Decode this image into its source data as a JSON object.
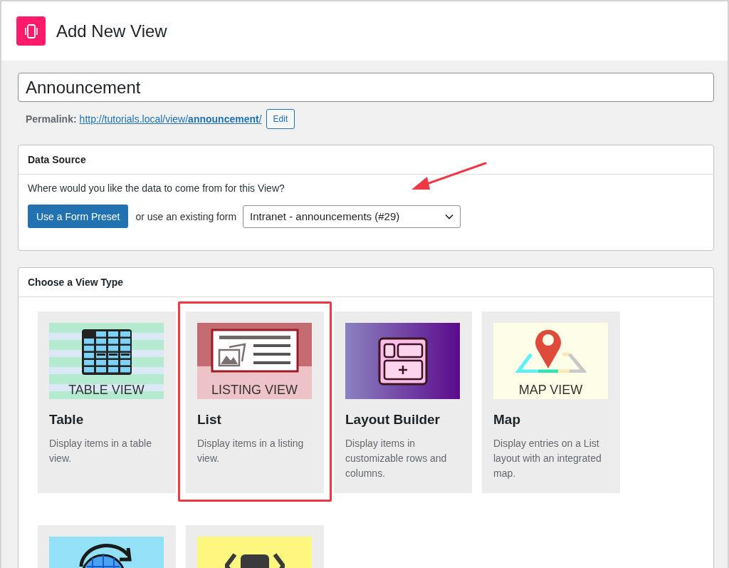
{
  "header": {
    "title": "Add New View"
  },
  "title_field": {
    "value": "Announcement"
  },
  "permalink": {
    "label": "Permalink:",
    "url": "http://tutorials.local/view/**announcement**/",
    "edit_button": "Edit"
  },
  "data_source": {
    "heading": "Data Source",
    "question": "Where would you like the data to come from for this View?",
    "preset_button": "Use a Form Preset",
    "or_text": "or use an existing form",
    "form_select": {
      "value": "Intranet - announcements (#29)"
    }
  },
  "view_type": {
    "heading": "Choose a View Type",
    "types": [
      {
        "kind": "table",
        "thumbnail_label": "TABLE VIEW",
        "name": "Table",
        "description": "Display items in a table view.",
        "selected": false
      },
      {
        "kind": "list",
        "thumbnail_label": "LISTING VIEW",
        "name": "List",
        "description": "Display items in a listing view.",
        "selected": true
      },
      {
        "kind": "layout",
        "name": "Layout Builder",
        "description": "Display items in customizable rows and columns.",
        "selected": false
      },
      {
        "kind": "map",
        "thumbnail_label": "MAP VIEW",
        "name": "Map",
        "description": "Display entries on a List layout with an integrated map.",
        "selected": false
      },
      {
        "kind": "globe",
        "selected": false
      },
      {
        "kind": "diy",
        "selected": false
      }
    ]
  }
}
